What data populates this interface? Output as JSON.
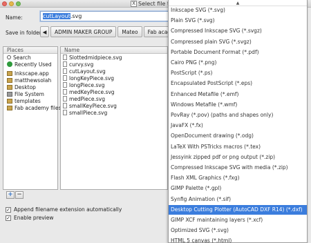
{
  "window": {
    "title": "Select file to s"
  },
  "name_row": {
    "label": "Name:",
    "value_selected": "cutLayout",
    "value_rest": ".svg"
  },
  "folder_row": {
    "label": "Save in folder:",
    "crumbs": [
      "ADMIN MAKER GROUP",
      "Mateo",
      "Fab academy files"
    ]
  },
  "places": {
    "header": "Places",
    "items": [
      "Search",
      "Recently Used",
      "Inkscape.app",
      "matthewsolah",
      "Desktop",
      "File System",
      "templates",
      "Fab academy files"
    ]
  },
  "files": {
    "header": "Name",
    "items": [
      "Slottedmidpiece.svg",
      "curvy.svg",
      "cutLayout.svg",
      "longKeyPiece.svg",
      "longPiece.svg",
      "medKeyPiece.svg",
      "medPiece.svg",
      "smallKeyPiece.svg",
      "smallPiece.svg"
    ]
  },
  "checkboxes": {
    "append_ext": {
      "label": "Append filename extension automatically",
      "checked": true
    },
    "preview": {
      "label": "Enable preview",
      "checked": true
    }
  },
  "dropdown": {
    "options": [
      "Inkscape SVG (*.svg)",
      "Plain SVG (*.svg)",
      "Compressed Inkscape SVG (*.svgz)",
      "Compressed plain SVG (*.svgz)",
      "Portable Document Format (*.pdf)",
      "Cairo PNG (*.png)",
      "PostScript (*.ps)",
      "Encapsulated PostScript (*.eps)",
      "Enhanced Metafile (*.emf)",
      "Windows Metafile (*.wmf)",
      "PovRay (*.pov) (paths and shapes only)",
      "JavaFX (*.fx)",
      "OpenDocument drawing (*.odg)",
      "LaTeX With PSTricks macros (*.tex)",
      "Jessyink zipped pdf or png output (*.zip)",
      "Compressed Inkscape SVG with media (*.zip)",
      "Flash XML Graphics (*.fxg)",
      "GIMP Palette (*.gpl)",
      "Synfig Animation (*.sif)",
      "Desktop Cutting Plotter (AutoCAD DXF R14) (*.dxf)",
      "GIMP XCF maintaining layers (*.xcf)",
      "Optimized SVG (*.svg)",
      "HTML 5 canvas (*.html)"
    ],
    "selected_index": 19
  }
}
